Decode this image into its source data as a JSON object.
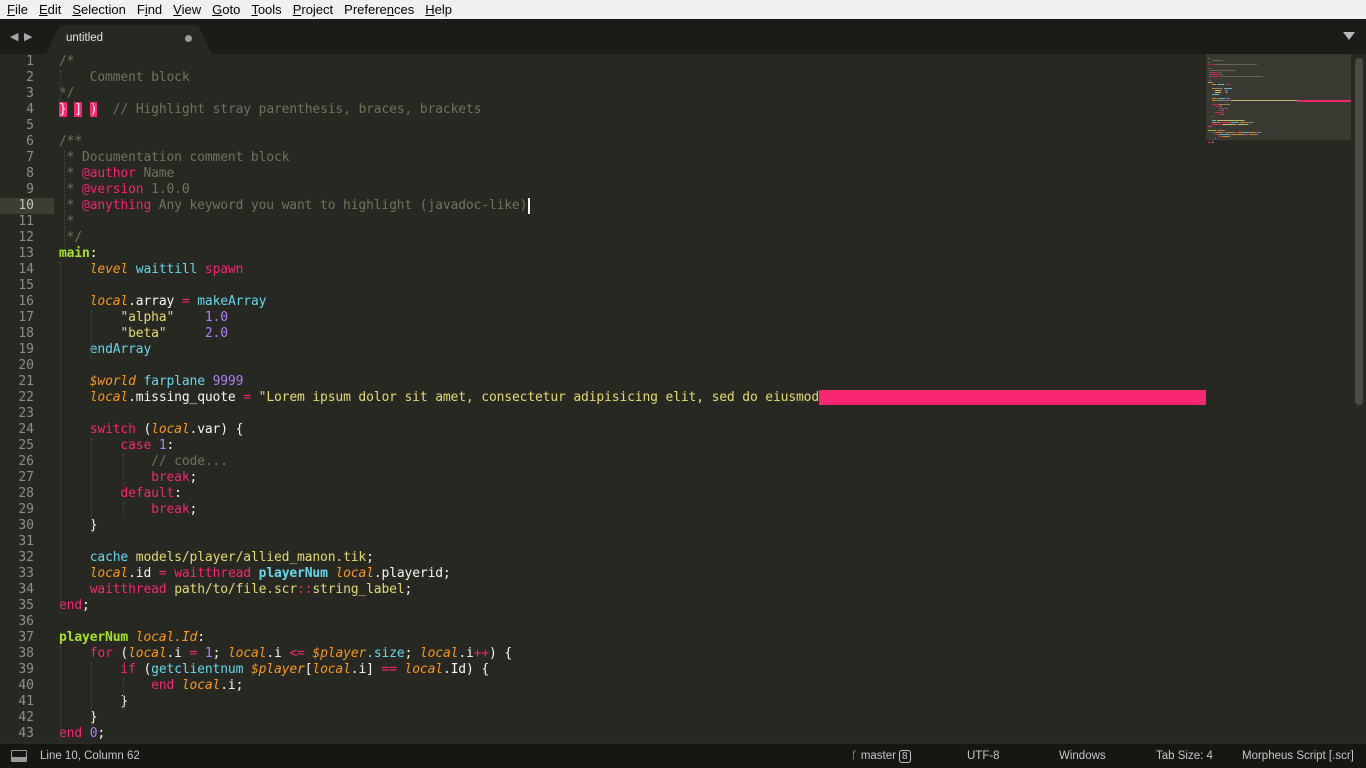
{
  "menubar": {
    "items": [
      {
        "pre": "",
        "u": "F",
        "post": "ile"
      },
      {
        "pre": "",
        "u": "E",
        "post": "dit"
      },
      {
        "pre": "",
        "u": "S",
        "post": "election"
      },
      {
        "pre": "F",
        "u": "i",
        "post": "nd"
      },
      {
        "pre": "",
        "u": "V",
        "post": "iew"
      },
      {
        "pre": "",
        "u": "G",
        "post": "oto"
      },
      {
        "pre": "",
        "u": "T",
        "post": "ools"
      },
      {
        "pre": "",
        "u": "P",
        "post": "roject"
      },
      {
        "pre": "Prefere",
        "u": "n",
        "post": "ces"
      },
      {
        "pre": "",
        "u": "H",
        "post": "elp"
      }
    ]
  },
  "tabbar": {
    "nav_back": "◀",
    "nav_forward": "▶",
    "tab_title": "untitled",
    "tab_dirty": true
  },
  "editor": {
    "current_line": 10,
    "line_count": 43,
    "colors": {
      "background": "#272822",
      "comment": "#75715e",
      "keyword": "#f92672",
      "function": "#66d9ef",
      "variable": "#fd971f",
      "string": "#e6db74",
      "number": "#ae81ff",
      "label": "#a6e22e",
      "invalid": "#f92672"
    },
    "lines": [
      [
        [
          "c-cmt",
          "/*"
        ]
      ],
      [
        [
          "c-cmt",
          "    Comment block"
        ]
      ],
      [
        [
          "c-cmt",
          "*/"
        ]
      ],
      [
        [
          "c-stray",
          "}"
        ],
        [
          "c-id",
          " "
        ],
        [
          "c-stray",
          "]"
        ],
        [
          "c-id",
          " "
        ],
        [
          "c-stray",
          ")"
        ],
        [
          "c-id",
          "  "
        ],
        [
          "c-cmt",
          "// Highlight stray parenthesis, braces, brackets"
        ]
      ],
      [],
      [
        [
          "c-cmt",
          "/**"
        ]
      ],
      [
        [
          "c-cmt",
          " * Documentation comment block"
        ]
      ],
      [
        [
          "c-cmt",
          " * "
        ],
        [
          "c-tag",
          "@author"
        ],
        [
          "c-cmt",
          " Name"
        ]
      ],
      [
        [
          "c-cmt",
          " * "
        ],
        [
          "c-tag",
          "@version"
        ],
        [
          "c-cmt",
          " 1.0.0"
        ]
      ],
      [
        [
          "c-cmt",
          " * "
        ],
        [
          "c-tag",
          "@anything"
        ],
        [
          "c-cmt",
          " Any keyword you want to highlight (javadoc-like)"
        ]
      ],
      [
        [
          "c-cmt",
          " *"
        ]
      ],
      [
        [
          "c-cmt",
          " */"
        ]
      ],
      [
        [
          "c-lbl",
          "main"
        ],
        [
          "c-id",
          ":"
        ]
      ],
      [
        [
          "c-id",
          "    "
        ],
        [
          "c-var",
          "level"
        ],
        [
          "c-id",
          " "
        ],
        [
          "c-fn",
          "waittill"
        ],
        [
          "c-id",
          " "
        ],
        [
          "c-kw",
          "spawn"
        ]
      ],
      [],
      [
        [
          "c-id",
          "    "
        ],
        [
          "c-var",
          "local"
        ],
        [
          "c-id",
          ".array "
        ],
        [
          "c-kw",
          "="
        ],
        [
          "c-id",
          " "
        ],
        [
          "c-fn",
          "makeArray"
        ]
      ],
      [
        [
          "c-id",
          "        "
        ],
        [
          "c-str",
          "\"alpha\""
        ],
        [
          "c-id",
          "    "
        ],
        [
          "c-num",
          "1.0"
        ]
      ],
      [
        [
          "c-id",
          "        "
        ],
        [
          "c-str",
          "\"beta\""
        ],
        [
          "c-id",
          "     "
        ],
        [
          "c-num",
          "2.0"
        ]
      ],
      [
        [
          "c-id",
          "    "
        ],
        [
          "c-fn",
          "endArray"
        ]
      ],
      [],
      [
        [
          "c-id",
          "    "
        ],
        [
          "c-var",
          "$world"
        ],
        [
          "c-id",
          " "
        ],
        [
          "c-fn",
          "farplane"
        ],
        [
          "c-id",
          " "
        ],
        [
          "c-num",
          "9999"
        ]
      ],
      [
        [
          "c-id",
          "    "
        ],
        [
          "c-var",
          "local"
        ],
        [
          "c-id",
          ".missing_quote "
        ],
        [
          "c-kw",
          "="
        ],
        [
          "c-id",
          " "
        ],
        [
          "c-str",
          "\"Lorem ipsum dolor sit amet, consectetur adipisicing elit, sed do eiusmod"
        ]
      ],
      [],
      [
        [
          "c-id",
          "    "
        ],
        [
          "c-kw",
          "switch"
        ],
        [
          "c-id",
          " ("
        ],
        [
          "c-var",
          "local"
        ],
        [
          "c-id",
          ".var) {"
        ]
      ],
      [
        [
          "c-id",
          "        "
        ],
        [
          "c-kw",
          "case"
        ],
        [
          "c-id",
          " "
        ],
        [
          "c-num",
          "1"
        ],
        [
          "c-id",
          ":"
        ]
      ],
      [
        [
          "c-id",
          "            "
        ],
        [
          "c-cmt",
          "// code..."
        ]
      ],
      [
        [
          "c-id",
          "            "
        ],
        [
          "c-kw",
          "break"
        ],
        [
          "c-id",
          ";"
        ]
      ],
      [
        [
          "c-id",
          "        "
        ],
        [
          "c-kw",
          "default"
        ],
        [
          "c-id",
          ":"
        ]
      ],
      [
        [
          "c-id",
          "            "
        ],
        [
          "c-kw",
          "break"
        ],
        [
          "c-id",
          ";"
        ]
      ],
      [
        [
          "c-id",
          "    }"
        ]
      ],
      [],
      [
        [
          "c-id",
          "    "
        ],
        [
          "c-fn",
          "cache"
        ],
        [
          "c-id",
          " "
        ],
        [
          "c-ylw",
          "models/player/allied_manon.tik"
        ],
        [
          "c-id",
          ";"
        ]
      ],
      [
        [
          "c-id",
          "    "
        ],
        [
          "c-var",
          "local"
        ],
        [
          "c-id",
          ".id "
        ],
        [
          "c-kw",
          "="
        ],
        [
          "c-id",
          " "
        ],
        [
          "c-kw",
          "waitthread"
        ],
        [
          "c-id",
          " "
        ],
        [
          "c-blu-b",
          "playerNum"
        ],
        [
          "c-id",
          " "
        ],
        [
          "c-var",
          "local"
        ],
        [
          "c-id",
          ".playerid;"
        ]
      ],
      [
        [
          "c-id",
          "    "
        ],
        [
          "c-kw",
          "waitthread"
        ],
        [
          "c-id",
          " "
        ],
        [
          "c-ylw",
          "path/to/file.scr"
        ],
        [
          "c-kw",
          "::"
        ],
        [
          "c-ylw",
          "string_label"
        ],
        [
          "c-id",
          ";"
        ]
      ],
      [
        [
          "c-kw",
          "end"
        ],
        [
          "c-id",
          ";"
        ]
      ],
      [],
      [
        [
          "c-lbl",
          "playerNum"
        ],
        [
          "c-id",
          " "
        ],
        [
          "c-var",
          "local.Id"
        ],
        [
          "c-id",
          ":"
        ]
      ],
      [
        [
          "c-id",
          "    "
        ],
        [
          "c-kw",
          "for"
        ],
        [
          "c-id",
          " ("
        ],
        [
          "c-var",
          "local"
        ],
        [
          "c-id",
          ".i "
        ],
        [
          "c-kw",
          "="
        ],
        [
          "c-id",
          " "
        ],
        [
          "c-num",
          "1"
        ],
        [
          "c-id",
          "; "
        ],
        [
          "c-var",
          "local"
        ],
        [
          "c-id",
          ".i "
        ],
        [
          "c-kw",
          "<="
        ],
        [
          "c-id",
          " "
        ],
        [
          "c-var",
          "$player"
        ],
        [
          "c-fn",
          ".size"
        ],
        [
          "c-id",
          "; "
        ],
        [
          "c-var",
          "local"
        ],
        [
          "c-id",
          ".i"
        ],
        [
          "c-kw",
          "++"
        ],
        [
          "c-id",
          ") {"
        ]
      ],
      [
        [
          "c-id",
          "        "
        ],
        [
          "c-kw",
          "if"
        ],
        [
          "c-id",
          " ("
        ],
        [
          "c-fn",
          "getclientnum"
        ],
        [
          "c-id",
          " "
        ],
        [
          "c-var",
          "$player"
        ],
        [
          "c-id",
          "["
        ],
        [
          "c-var",
          "local"
        ],
        [
          "c-id",
          ".i] "
        ],
        [
          "c-kw",
          "=="
        ],
        [
          "c-id",
          " "
        ],
        [
          "c-var",
          "local"
        ],
        [
          "c-id",
          ".Id) {"
        ]
      ],
      [
        [
          "c-id",
          "            "
        ],
        [
          "c-kw",
          "end"
        ],
        [
          "c-id",
          " "
        ],
        [
          "c-var",
          "local"
        ],
        [
          "c-id",
          ".i;"
        ]
      ],
      [
        [
          "c-id",
          "        }"
        ]
      ],
      [
        [
          "c-id",
          "    }"
        ]
      ],
      [
        [
          "c-kw",
          "end"
        ],
        [
          "c-id",
          " "
        ],
        [
          "c-num",
          "0"
        ],
        [
          "c-id",
          ";"
        ]
      ]
    ]
  },
  "statusbar": {
    "position": "Line 10, Column 62",
    "branch": "master",
    "branch_count": "8",
    "encoding": "UTF-8",
    "line_endings": "Windows",
    "tab_size": "Tab Size: 4",
    "syntax": "Morpheus Script [.scr]"
  }
}
